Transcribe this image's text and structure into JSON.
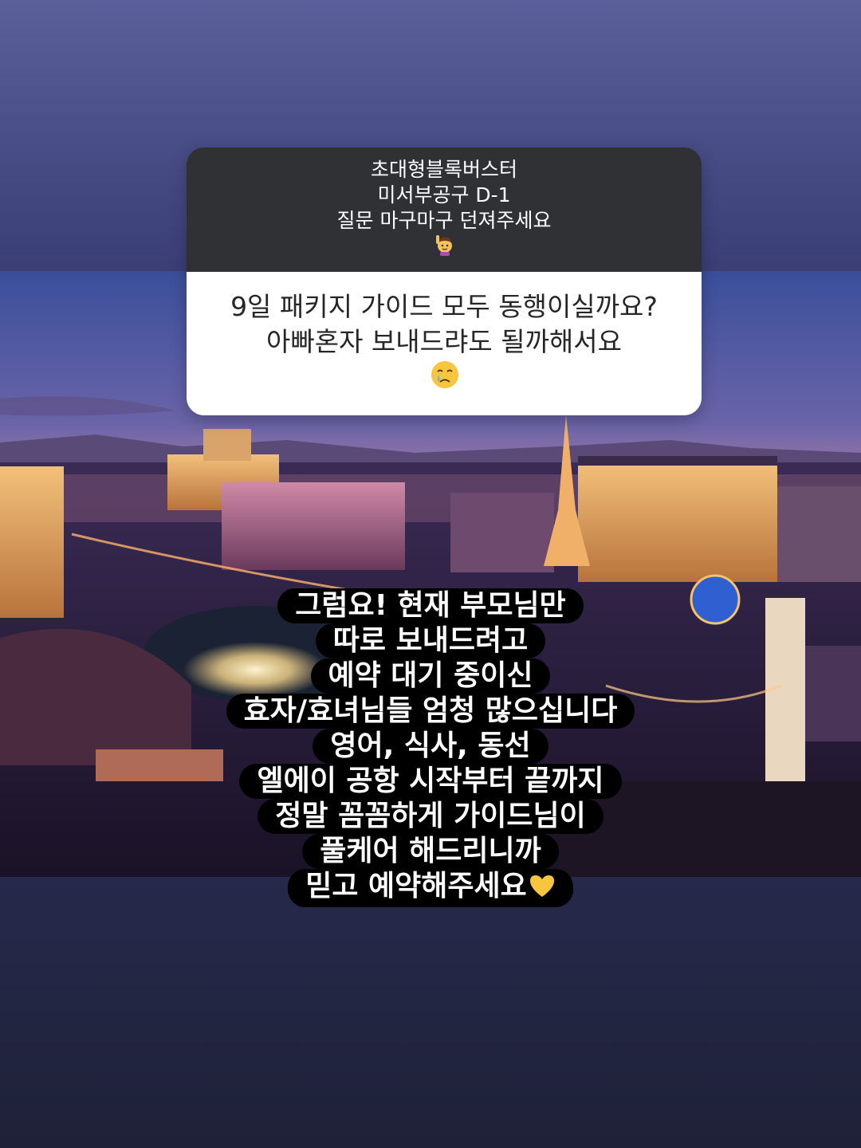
{
  "question_sticker": {
    "prompt_lines": [
      "초대형블록버스터",
      "미서부공구 D-1",
      "질문 마구마구 던져주세요"
    ],
    "prompt_emoji": "raising-hand-emoji",
    "question_lines": [
      "9일 패키지 가이드 모두 동행이실까요?",
      "아빠혼자 보내드랴도 될까해서요"
    ],
    "question_emoji": "crying-face-emoji"
  },
  "answer": {
    "lines": [
      "그럼요! 현재 부모님만",
      "따로 보내드려고",
      "예약 대기 중이신",
      "효자/효녀님들 엄청 많으십니다",
      "영어, 식사, 동선",
      "엘에이 공항 시작부터 끝까지",
      "정말 꼼꼼하게 가이드님이",
      "풀케어 해드리니까",
      "믿고 예약해주세요"
    ],
    "end_emoji": "yellow-heart-emoji"
  },
  "background": {
    "photo": "las-vegas-strip-night",
    "colors": {
      "top": "#5b5f9a",
      "bottom": "#1f2138",
      "sticker_header": "#2f3134",
      "caption_bg": "#000000"
    }
  }
}
